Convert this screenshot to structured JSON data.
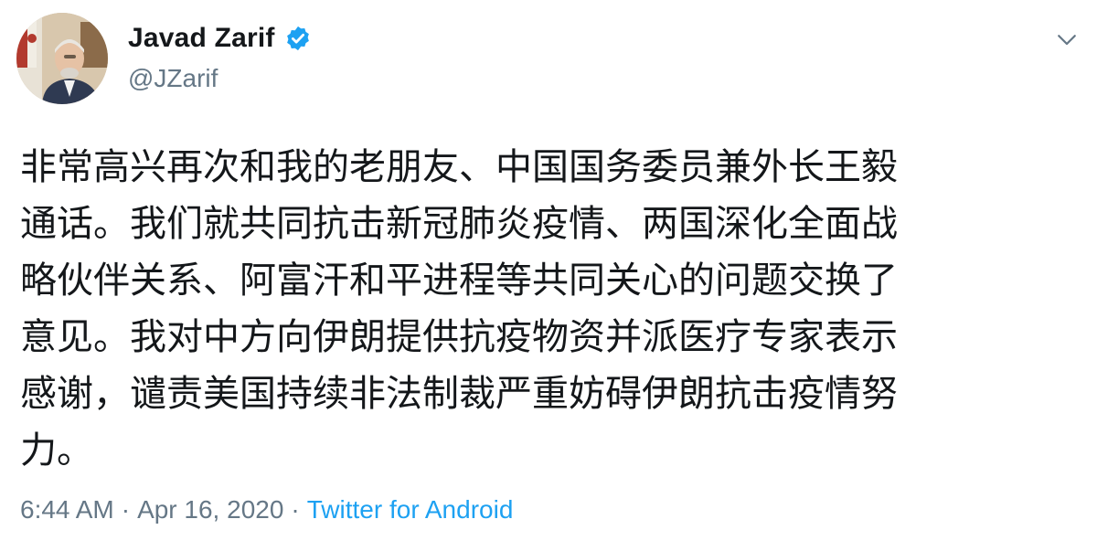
{
  "author": {
    "display_name": "Javad Zarif",
    "handle": "@JZarif",
    "verified": true,
    "avatar_icon": "profile-photo"
  },
  "tweet": {
    "lines": [
      "非常高兴再次和我的老朋友、中国国务委员兼外长王毅",
      "通话。我们就共同抗击新冠肺炎疫情、两国深化全面战",
      "略伙伴关系、阿富汗和平进程等共同关心的问题交换了",
      "意见。我对中方向伊朗提供抗疫物资并派医疗专家表示",
      "感谢，谴责美国持续非法制裁严重妨碍伊朗抗击疫情努",
      "力。"
    ]
  },
  "meta": {
    "time": "6:44 AM",
    "separator_1": "·",
    "date": "Apr 16, 2020",
    "separator_2": "·",
    "source": "Twitter for Android"
  },
  "icons": {
    "verified": "verified-badge-icon",
    "menu": "chevron-down-icon"
  },
  "colors": {
    "text_primary": "#14171a",
    "text_secondary": "#657786",
    "link": "#1da1f2",
    "verified": "#1da1f2"
  }
}
